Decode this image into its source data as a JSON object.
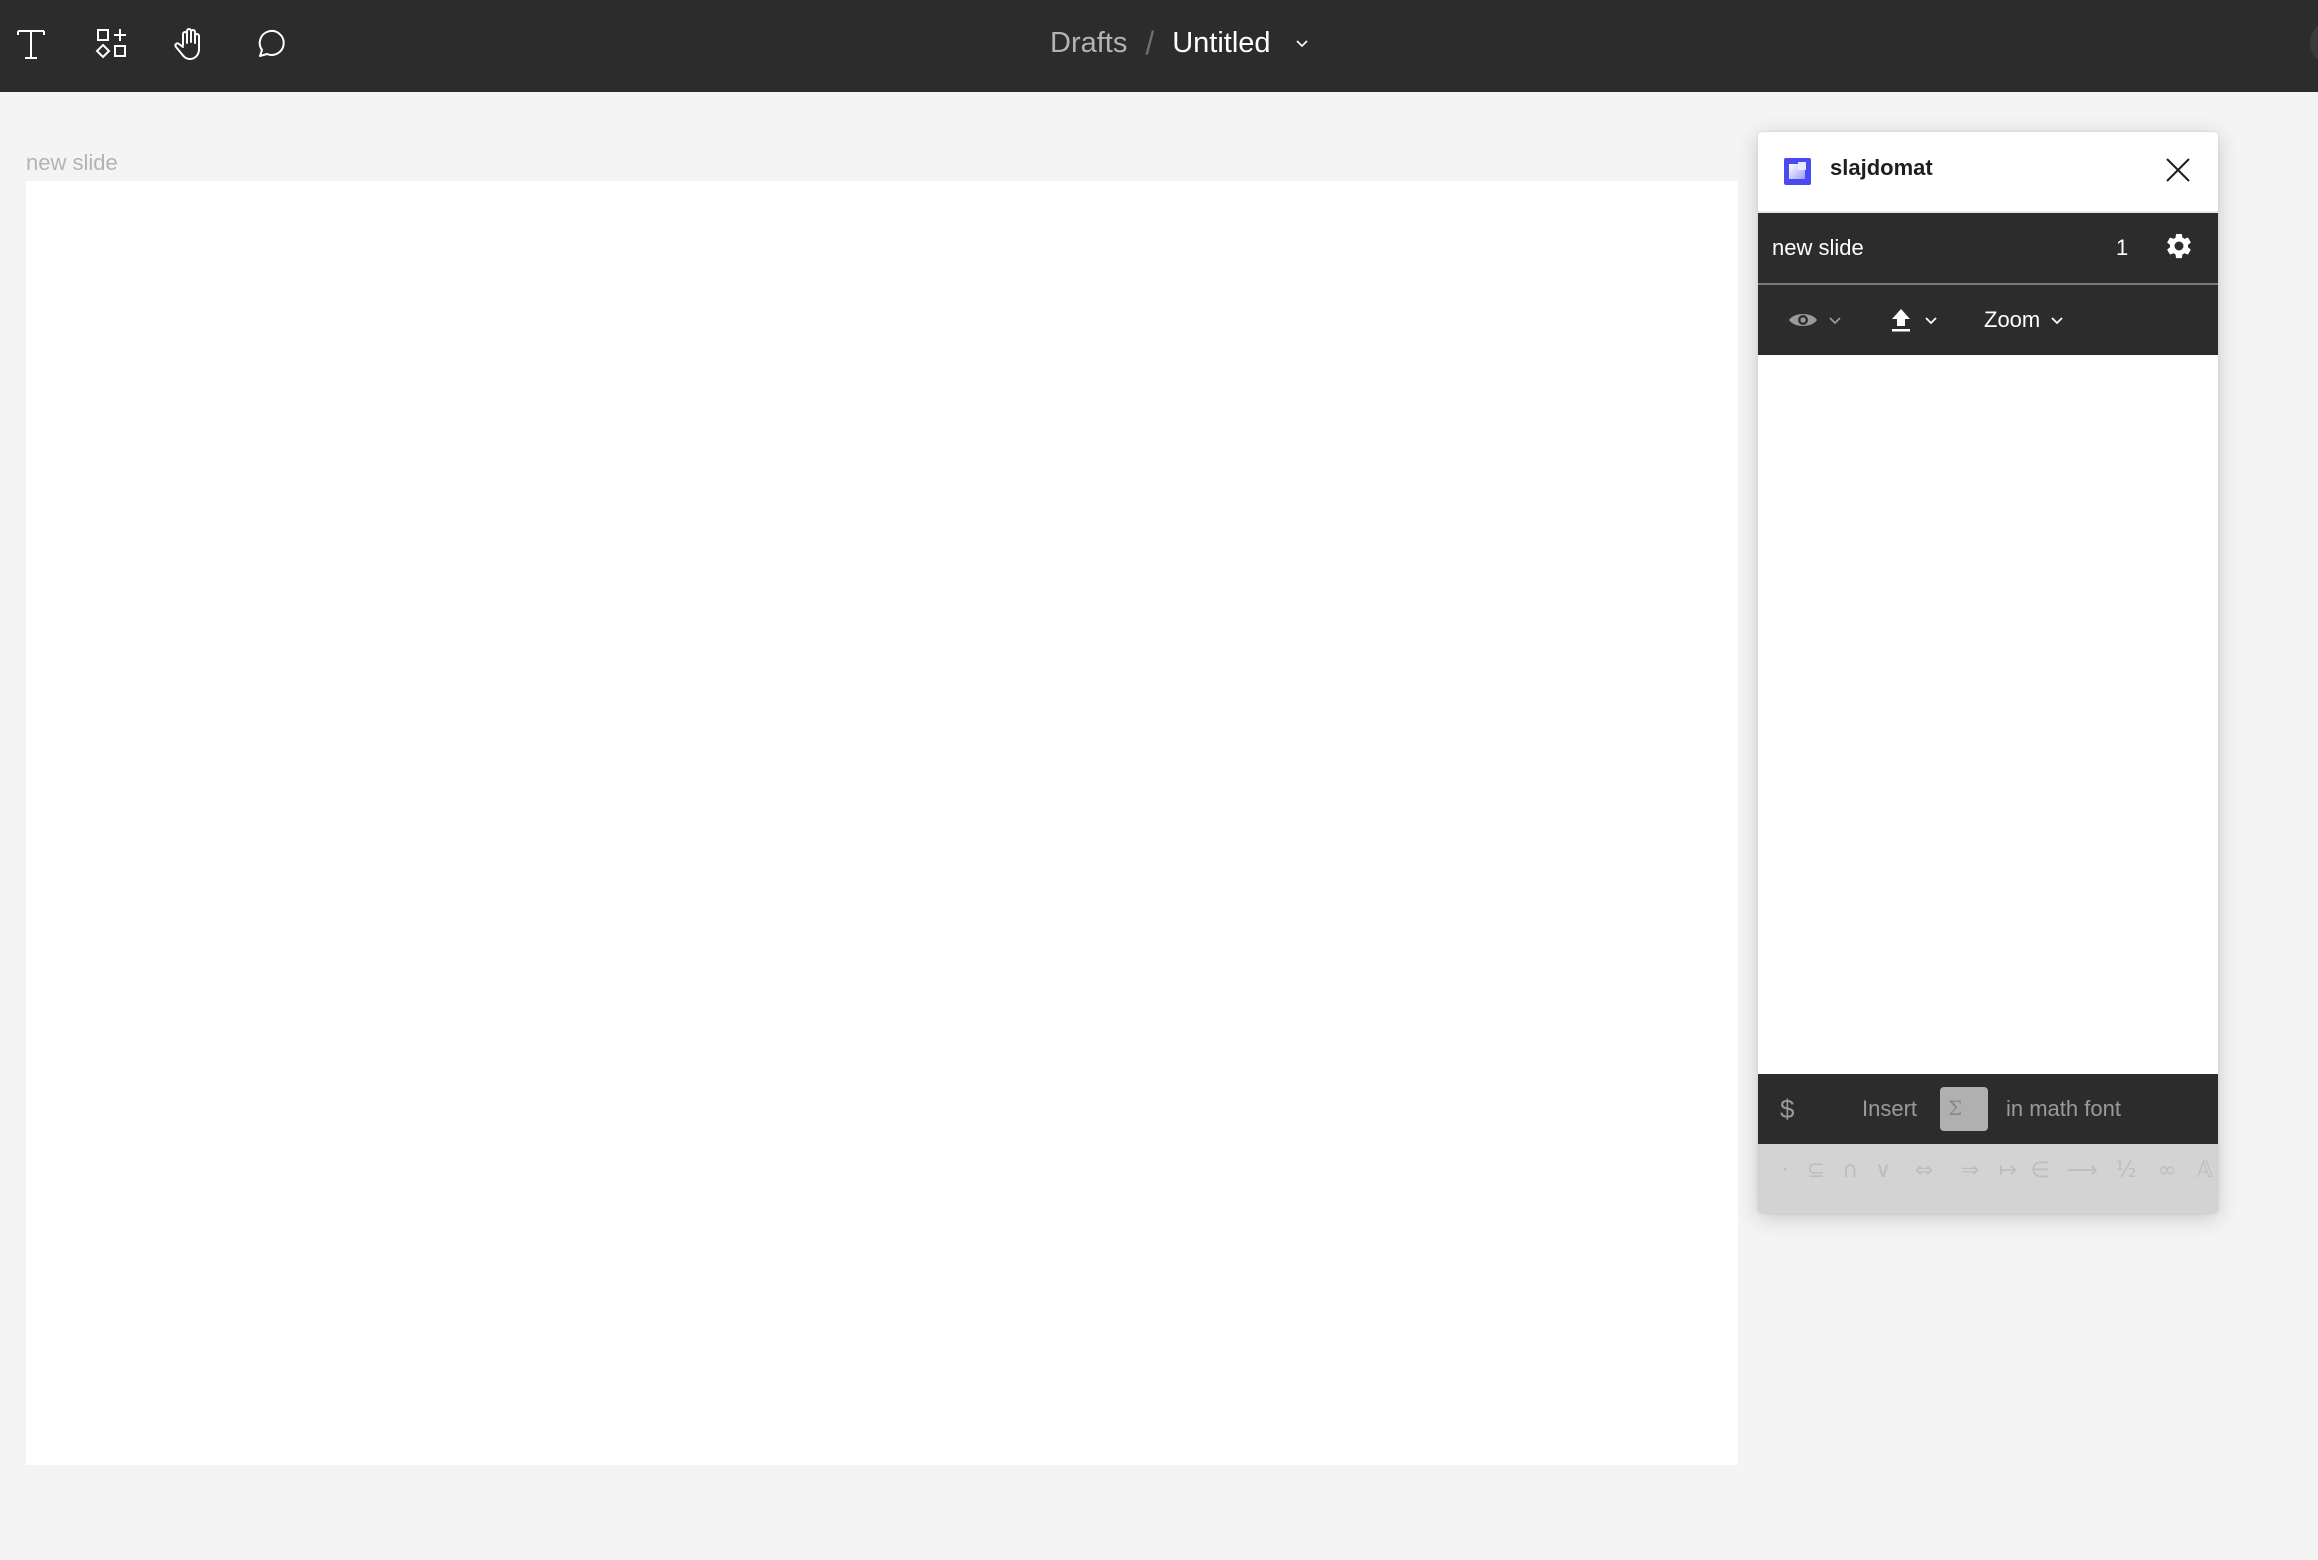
{
  "toolbar": {
    "tools": [
      {
        "name": "text-tool",
        "icon": "text-icon"
      },
      {
        "name": "resources-tool",
        "icon": "shapes-plus-icon"
      },
      {
        "name": "hand-tool",
        "icon": "hand-icon"
      },
      {
        "name": "comment-tool",
        "icon": "speech-bubble-icon"
      }
    ]
  },
  "breadcrumb": {
    "parent": "Drafts",
    "separator": "/",
    "title": "Untitled",
    "menu_icon": "chevron-down-icon"
  },
  "canvas": {
    "frame_label": "new slide"
  },
  "plugin": {
    "name": "slajdomat",
    "brand_color": "#4a4af4",
    "slide_row": {
      "title": "new slide",
      "count": "1",
      "settings_icon": "gear-icon"
    },
    "toolbar": {
      "view_icon": "eye-icon",
      "export_icon": "upload-icon",
      "zoom_label": "Zoom"
    },
    "math_bar": {
      "dollar": "$",
      "insert_label": "Insert",
      "sigma": "Σ",
      "suffix_label": "in math font"
    },
    "symbols": [
      "·",
      "⊆",
      "∩",
      "∨",
      "⇔",
      "⇒",
      "↦",
      "∈",
      "⟶",
      "½",
      "∞",
      "𝔸"
    ]
  }
}
